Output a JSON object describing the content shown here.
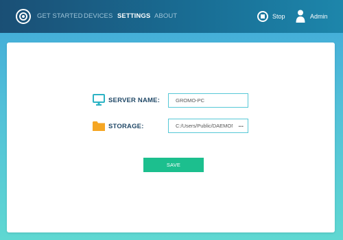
{
  "header": {
    "logo_icon": "target-circle-icon",
    "nav": [
      "GET STARTED",
      "DEVICES",
      "SETTINGS",
      "ABOUT"
    ],
    "active_nav": "SETTINGS",
    "stop_label": "Stop",
    "stop_icon": "stop-circle-icon",
    "user_label": "Admin",
    "user_icon": "user-icon"
  },
  "settings": {
    "server_name": {
      "label": "SERVER NAME:",
      "value": "GROMO-PC",
      "icon": "monitor-icon"
    },
    "storage": {
      "label": "STORAGE:",
      "value": "C:/Users/Public/DAEMONSync",
      "browse_label": "...",
      "icon": "folder-icon"
    },
    "save_label": "SAVE"
  },
  "colors": {
    "header_dark": "#1a4f75",
    "header_light": "#1d86ab",
    "background_top": "#3fa8d9",
    "background_bottom": "#5fd8d2",
    "accent_teal": "#55c8d6",
    "save_green": "#1cbf8e",
    "folder_orange": "#f5a623",
    "label_navy": "#1f4766"
  }
}
